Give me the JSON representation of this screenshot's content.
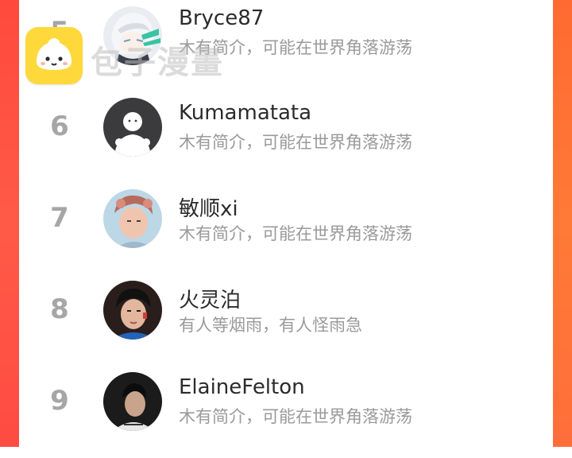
{
  "watermark": {
    "app_name": "包子漫畫",
    "logo_color": "#ffd93b"
  },
  "theme": {
    "left_edge": "#ff4a3d",
    "right_edge": "#ff6a32",
    "rank_color": "#a6a6a6",
    "name_color": "#2b2b2b",
    "bio_color": "#9a9a9a"
  },
  "users": [
    {
      "rank": "5",
      "name": "Bryce87",
      "bio": "木有简介，可能在世界角落游荡",
      "avatar": "anime-girl-avatar"
    },
    {
      "rank": "6",
      "name": "Kumamatata",
      "bio": "木有简介，可能在世界角落游荡",
      "avatar": "default-user-avatar"
    },
    {
      "rank": "7",
      "name": "敏顺xi",
      "bio": "木有简介，可能在世界角落游荡",
      "avatar": "photo-avatar"
    },
    {
      "rank": "8",
      "name": "火灵泊",
      "bio": "有人等烟雨，有人怪雨急",
      "avatar": "photo-avatar"
    },
    {
      "rank": "9",
      "name": "ElaineFelton",
      "bio": "木有简介，可能在世界角落游荡",
      "avatar": "photo-avatar"
    }
  ]
}
